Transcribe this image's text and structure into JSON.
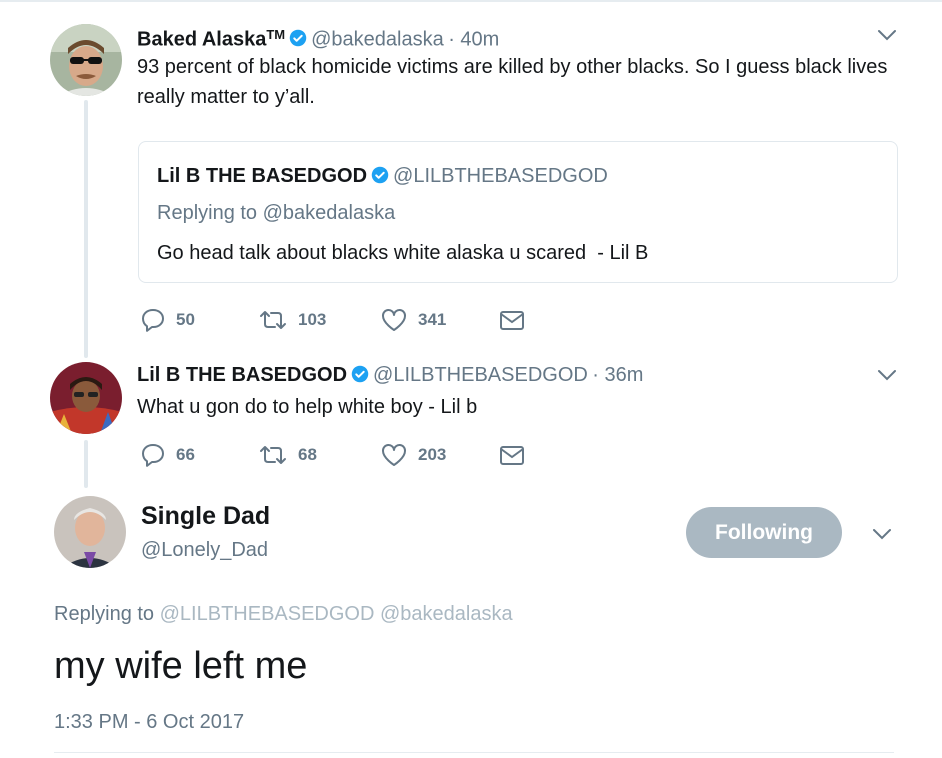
{
  "tweet1": {
    "name": "Baked Alaska",
    "tm": "TM",
    "handle": "@bakedalaska",
    "time": "· 40m",
    "text": "93 percent of black homicide victims are killed by other blacks. So I guess black lives really matter to y’all.",
    "quote": {
      "name": "Lil B THE BASEDGOD",
      "handle": "@LILBTHEBASEDGOD",
      "replying": "Replying to @bakedalaska",
      "text": "Go head talk about blacks white alaska u scared  - Lil B"
    },
    "replies": "50",
    "retweets": "103",
    "likes": "341"
  },
  "tweet2": {
    "name": "Lil B THE BASEDGOD",
    "handle": "@LILBTHEBASEDGOD",
    "time": "· 36m",
    "text": "What u gon do to help white boy - Lil b",
    "replies": "66",
    "retweets": "68",
    "likes": "203"
  },
  "main": {
    "name": "Single Dad",
    "handle": "@Lonely_Dad",
    "follow_label": "Following",
    "replying_prefix": "Replying to",
    "replying_to_1": "@LILBTHEBASEDGOD",
    "replying_to_2": "@bakedalaska",
    "text": "my wife left me",
    "timestamp": "1:33 PM - 6 Oct 2017"
  },
  "colors": {
    "verified": "#1da1f2",
    "muted": "#657786",
    "follow_bg": "#aab8c2"
  },
  "icons": [
    "verified-badge-icon",
    "chevron-down-icon",
    "reply-icon",
    "retweet-icon",
    "like-icon",
    "message-icon"
  ]
}
